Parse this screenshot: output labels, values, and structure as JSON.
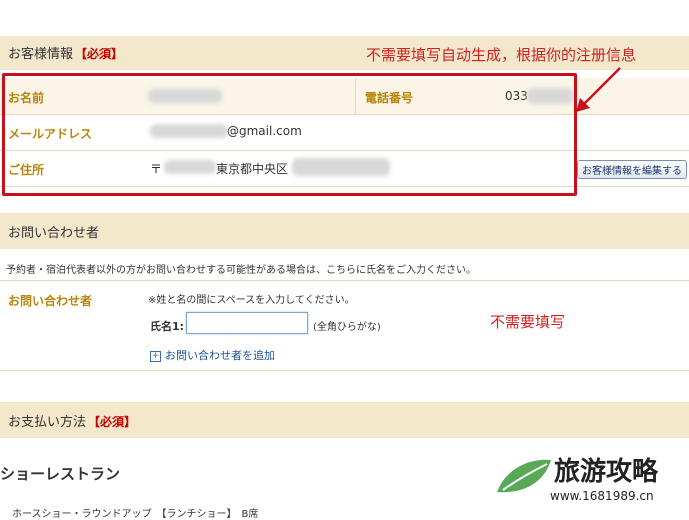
{
  "customer_info": {
    "title": "お客様情報",
    "required": "【必須】",
    "name_label": "お名前",
    "phone_label": "電話番号",
    "phone_value": "033",
    "email_label": "メールアドレス",
    "email_value": "@gmail.com",
    "address_label": "ご住所",
    "postal_mark": "〒",
    "address_value": "東京都中央区",
    "edit_button": "お客様情報を編集する"
  },
  "contact_person": {
    "title": "お問い合わせ者",
    "description": "予約者・宿泊代表者以外の方がお問い合わせする可能性がある場合は、こちらに氏名をご入力ください。",
    "label": "お問い合わせ者",
    "note": "※姓と名の間にスペースを入力してください。",
    "name_field_label": "氏名1:",
    "name_field_value": "",
    "name_field_hint": "(全角ひらがな)",
    "add_link": "お問い合わせ者を追加"
  },
  "payment": {
    "title": "お支払い方法",
    "required": "【必須】"
  },
  "show_restaurant": {
    "title": "ショーレストラン",
    "item_text": "ホースショー・ラウンドアップ　【ランチショー】　B席"
  },
  "annotations": {
    "auto_generated": "不需要填写自动生成，根据你的注册信息",
    "no_need": "不需要填写"
  },
  "watermark": {
    "brand": "旅游攻略",
    "url": "www.1681989.cn"
  },
  "colors": {
    "section_bg": "#f3e7cc",
    "label_gold": "#b8860b",
    "annotation_red": "#d21f1f",
    "required_red": "#cc0000"
  }
}
